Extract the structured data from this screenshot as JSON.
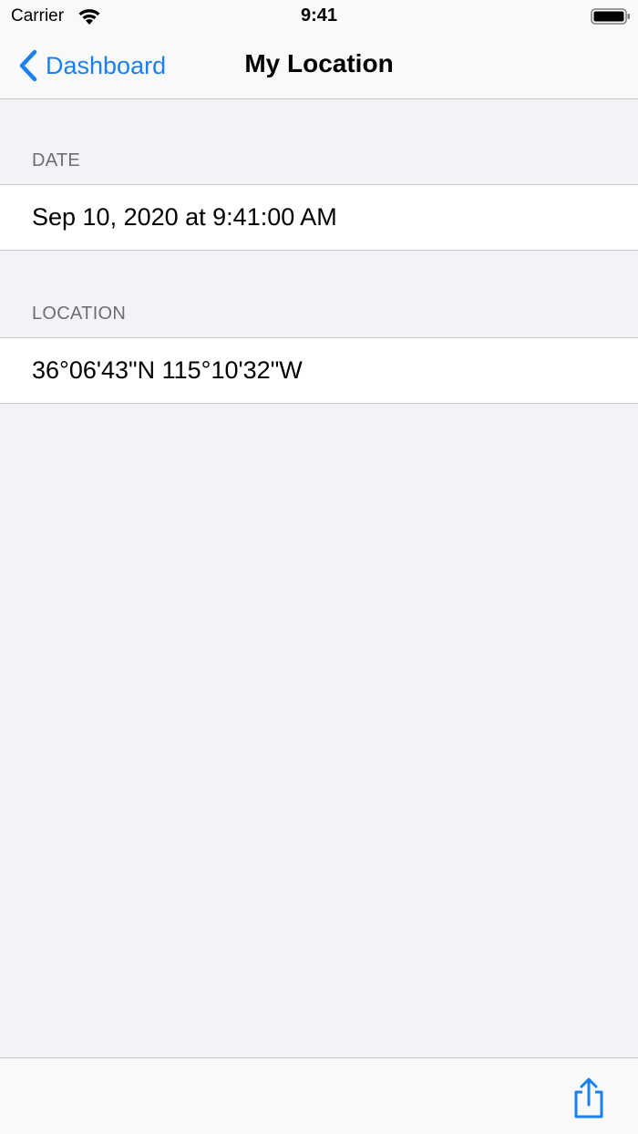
{
  "status_bar": {
    "carrier": "Carrier",
    "time": "9:41"
  },
  "nav": {
    "back_label": "Dashboard",
    "title": "My Location"
  },
  "sections": {
    "date": {
      "header": "DATE",
      "value": "Sep 10, 2020 at 9:41:00 AM"
    },
    "location": {
      "header": "LOCATION",
      "value": "36°06'43\"N 115°10'32\"W"
    }
  },
  "toolbar": {
    "share_icon": "share-icon"
  },
  "colors": {
    "accent": "#1a7ff2",
    "background": "#f2f2f7",
    "header_text": "#6d6d72"
  }
}
